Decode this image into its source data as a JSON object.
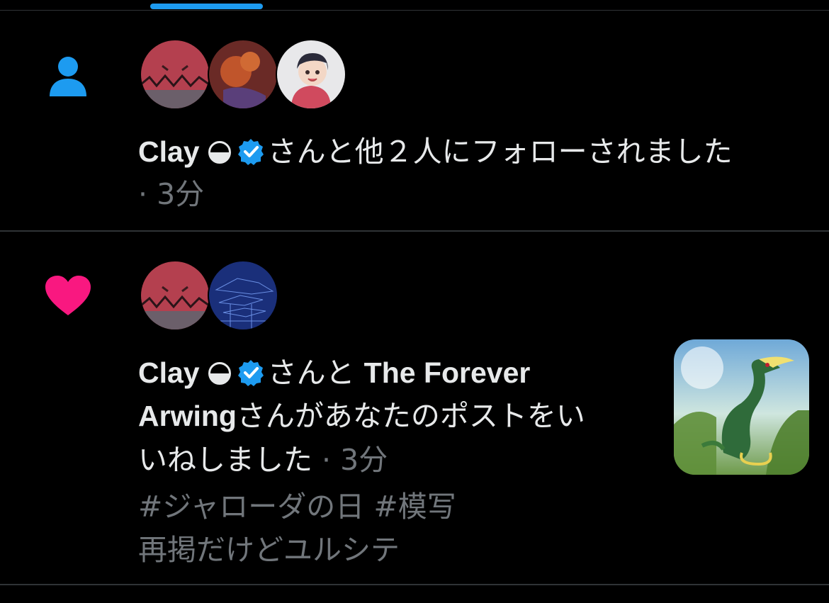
{
  "notifications": [
    {
      "type": "follow",
      "icon": "person-icon",
      "icon_color": "#1d9bf0",
      "actor_name": "Clay",
      "text_rest": "さんと他２人にフォローされました",
      "time": "· 3分"
    },
    {
      "type": "like",
      "icon": "heart-icon",
      "icon_color": "#f91880",
      "actor_name": "Clay",
      "between": "さんと",
      "second_actor_a": "The Forever",
      "second_actor_b": "Arwing",
      "text_rest_a": "さんがあなたのポストをい",
      "text_rest_b": "いねしました",
      "time": "· 3分",
      "post_hashtags": "#ジャローダの日 #模写",
      "post_text": "再掲だけどユルシテ"
    }
  ],
  "colors": {
    "background": "#000000",
    "accent": "#1d9bf0",
    "text": "#e7e9ea",
    "muted": "#71767b",
    "divider": "#2f3336"
  }
}
